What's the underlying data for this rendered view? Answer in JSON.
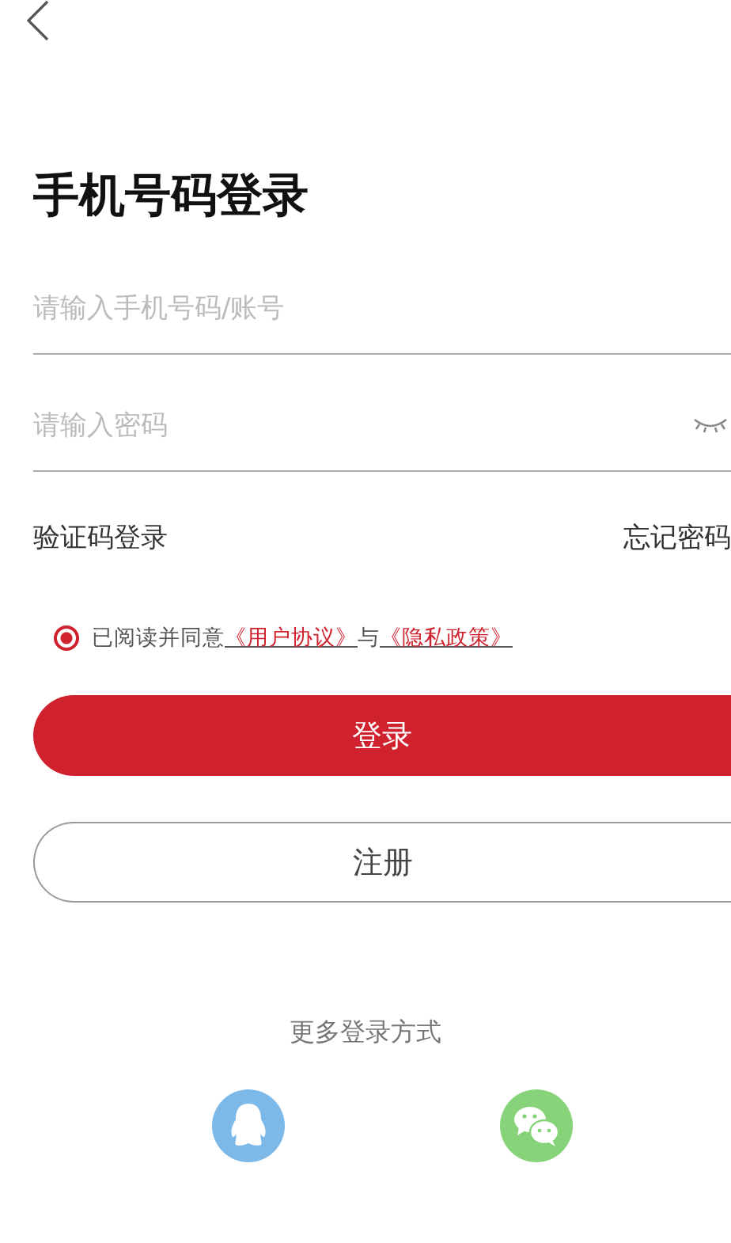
{
  "title": "手机号码登录",
  "phone_field": {
    "placeholder": "请输入手机号码/账号"
  },
  "password_field": {
    "placeholder": "请输入密码"
  },
  "links": [
    "验证码登录",
    "忘记密码"
  ],
  "agreement": {
    "checked": true,
    "text": "已阅读并同意",
    "link_1": "《用户协议》",
    "joiner": "与",
    "link_2": "《隐私政策》"
  },
  "buttons": [
    {
      "label": "登录",
      "kind": "primary"
    },
    {
      "label": "注册",
      "kind": "outline"
    }
  ],
  "more_login": {
    "label": "更多登录方式",
    "providers": [
      {
        "kind": "qq"
      },
      {
        "kind": "wechat"
      }
    ]
  }
}
